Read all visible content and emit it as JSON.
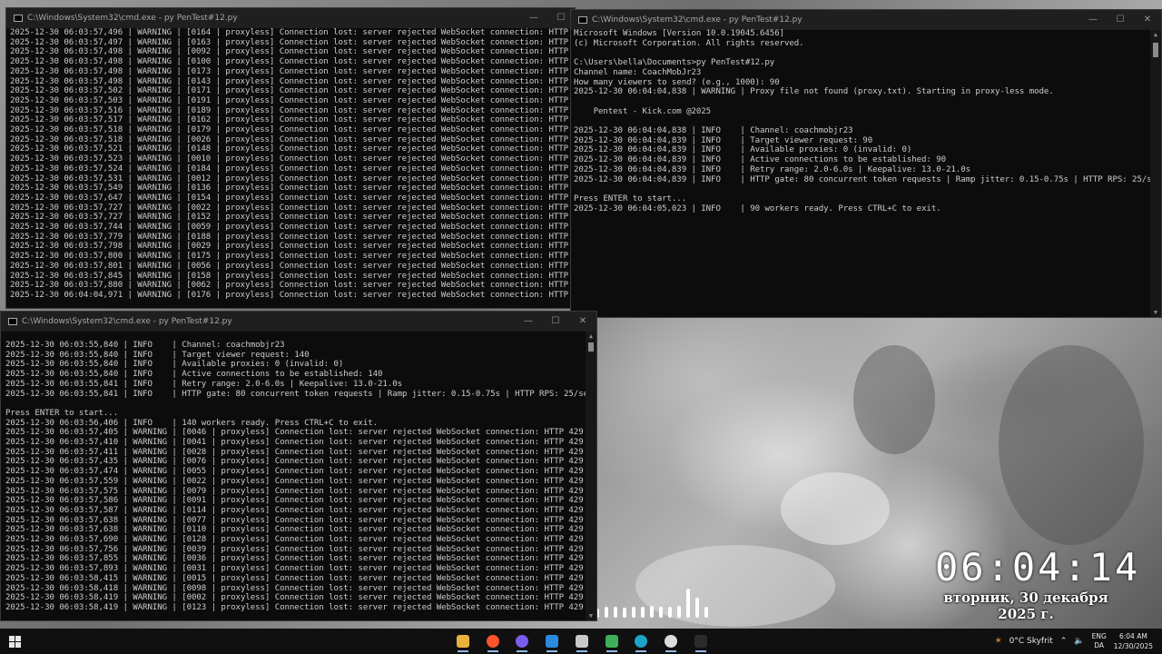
{
  "windows": {
    "cmd_top_left": {
      "title": "C:\\Windows\\System32\\cmd.exe - py  PenTest#12.py",
      "lines": [
        "2025-12-30 06:03:57,496 | WARNING | [0164 | proxyless] Connection lost: server rejected WebSocket connection: HTTP 429",
        "2025-12-30 06:03:57,497 | WARNING | [0163 | proxyless] Connection lost: server rejected WebSocket connection: HTTP 429",
        "2025-12-30 06:03:57,498 | WARNING | [0092 | proxyless] Connection lost: server rejected WebSocket connection: HTTP 429",
        "2025-12-30 06:03:57,498 | WARNING | [0100 | proxyless] Connection lost: server rejected WebSocket connection: HTTP 429",
        "2025-12-30 06:03:57,498 | WARNING | [0173 | proxyless] Connection lost: server rejected WebSocket connection: HTTP 429",
        "2025-12-30 06:03:57,498 | WARNING | [0143 | proxyless] Connection lost: server rejected WebSocket connection: HTTP 429",
        "2025-12-30 06:03:57,502 | WARNING | [0171 | proxyless] Connection lost: server rejected WebSocket connection: HTTP 429",
        "2025-12-30 06:03:57,503 | WARNING | [0191 | proxyless] Connection lost: server rejected WebSocket connection: HTTP 429",
        "2025-12-30 06:03:57,516 | WARNING | [0189 | proxyless] Connection lost: server rejected WebSocket connection: HTTP 429",
        "2025-12-30 06:03:57,517 | WARNING | [0162 | proxyless] Connection lost: server rejected WebSocket connection: HTTP 429",
        "2025-12-30 06:03:57,518 | WARNING | [0179 | proxyless] Connection lost: server rejected WebSocket connection: HTTP 429",
        "2025-12-30 06:03:57,518 | WARNING | [0026 | proxyless] Connection lost: server rejected WebSocket connection: HTTP 429",
        "2025-12-30 06:03:57,521 | WARNING | [0148 | proxyless] Connection lost: server rejected WebSocket connection: HTTP 429",
        "2025-12-30 06:03:57,523 | WARNING | [0010 | proxyless] Connection lost: server rejected WebSocket connection: HTTP 429",
        "2025-12-30 06:03:57,524 | WARNING | [0184 | proxyless] Connection lost: server rejected WebSocket connection: HTTP 429",
        "2025-12-30 06:03:57,531 | WARNING | [0012 | proxyless] Connection lost: server rejected WebSocket connection: HTTP 429",
        "2025-12-30 06:03:57,549 | WARNING | [0136 | proxyless] Connection lost: server rejected WebSocket connection: HTTP 429",
        "2025-12-30 06:03:57,647 | WARNING | [0154 | proxyless] Connection lost: server rejected WebSocket connection: HTTP 429",
        "2025-12-30 06:03:57,727 | WARNING | [0022 | proxyless] Connection lost: server rejected WebSocket connection: HTTP 429",
        "2025-12-30 06:03:57,727 | WARNING | [0152 | proxyless] Connection lost: server rejected WebSocket connection: HTTP 429",
        "2025-12-30 06:03:57,744 | WARNING | [0059 | proxyless] Connection lost: server rejected WebSocket connection: HTTP 429",
        "2025-12-30 06:03:57,779 | WARNING | [0188 | proxyless] Connection lost: server rejected WebSocket connection: HTTP 429",
        "2025-12-30 06:03:57,798 | WARNING | [0029 | proxyless] Connection lost: server rejected WebSocket connection: HTTP 429",
        "2025-12-30 06:03:57,800 | WARNING | [0175 | proxyless] Connection lost: server rejected WebSocket connection: HTTP 429",
        "2025-12-30 06:03:57,801 | WARNING | [0056 | proxyless] Connection lost: server rejected WebSocket connection: HTTP 429",
        "2025-12-30 06:03:57,845 | WARNING | [0158 | proxyless] Connection lost: server rejected WebSocket connection: HTTP 429",
        "2025-12-30 06:03:57,880 | WARNING | [0062 | proxyless] Connection lost: server rejected WebSocket connection: HTTP 429",
        "2025-12-30 06:04:04,971 | WARNING | [0176 | proxyless] Connection lost: server rejected WebSocket connection: HTTP 429"
      ]
    },
    "cmd_top_right": {
      "title": "C:\\Windows\\System32\\cmd.exe - py  PenTest#12.py",
      "lines": [
        "Microsoft Windows [Version 10.0.19045.6456]",
        "(c) Microsoft Corporation. All rights reserved.",
        "",
        "C:\\Users\\bella\\Documents>py PenTest#12.py",
        "Channel name: CoachMobJr23",
        "How many viewers to send? (e.g., 1000): 90",
        "2025-12-30 06:04:04,838 | WARNING | Proxy file not found (proxy.txt). Starting in proxy-less mode.",
        "",
        "    Pentest - Kick.com @2025",
        "",
        "2025-12-30 06:04:04,838 | INFO    | Channel: coachmobjr23",
        "2025-12-30 06:04:04,839 | INFO    | Target viewer request: 90",
        "2025-12-30 06:04:04,839 | INFO    | Available proxies: 0 (invalid: 0)",
        "2025-12-30 06:04:04,839 | INFO    | Active connections to be established: 90",
        "2025-12-30 06:04:04,839 | INFO    | Retry range: 2.0-6.0s | Keepalive: 13.0-21.0s",
        "2025-12-30 06:04:04,839 | INFO    | HTTP gate: 80 concurrent token requests | Ramp jitter: 0.15-0.75s | HTTP RPS: 25/sec",
        "",
        "Press ENTER to start...",
        "2025-12-30 06:04:05,023 | INFO    | 90 workers ready. Press CTRL+C to exit."
      ]
    },
    "cmd_bottom": {
      "title": "C:\\Windows\\System32\\cmd.exe - py  PenTest#12.py",
      "lines": [
        "2025-12-30 06:03:55,840 | INFO    | Channel: coachmobjr23",
        "2025-12-30 06:03:55,840 | INFO    | Target viewer request: 140",
        "2025-12-30 06:03:55,840 | INFO    | Available proxies: 0 (invalid: 0)",
        "2025-12-30 06:03:55,840 | INFO    | Active connections to be established: 140",
        "2025-12-30 06:03:55,841 | INFO    | Retry range: 2.0-6.0s | Keepalive: 13.0-21.0s",
        "2025-12-30 06:03:55,841 | INFO    | HTTP gate: 80 concurrent token requests | Ramp jitter: 0.15-0.75s | HTTP RPS: 25/sec",
        "",
        "Press ENTER to start...",
        "2025-12-30 06:03:56,406 | INFO    | 140 workers ready. Press CTRL+C to exit.",
        "2025-12-30 06:03:57,405 | WARNING | [0046 | proxyless] Connection lost: server rejected WebSocket connection: HTTP 429",
        "2025-12-30 06:03:57,410 | WARNING | [0041 | proxyless] Connection lost: server rejected WebSocket connection: HTTP 429",
        "2025-12-30 06:03:57,411 | WARNING | [0028 | proxyless] Connection lost: server rejected WebSocket connection: HTTP 429",
        "2025-12-30 06:03:57,435 | WARNING | [0076 | proxyless] Connection lost: server rejected WebSocket connection: HTTP 429",
        "2025-12-30 06:03:57,474 | WARNING | [0055 | proxyless] Connection lost: server rejected WebSocket connection: HTTP 429",
        "2025-12-30 06:03:57,559 | WARNING | [0022 | proxyless] Connection lost: server rejected WebSocket connection: HTTP 429",
        "2025-12-30 06:03:57,575 | WARNING | [0079 | proxyless] Connection lost: server rejected WebSocket connection: HTTP 429",
        "2025-12-30 06:03:57,586 | WARNING | [0091 | proxyless] Connection lost: server rejected WebSocket connection: HTTP 429",
        "2025-12-30 06:03:57,587 | WARNING | [0114 | proxyless] Connection lost: server rejected WebSocket connection: HTTP 429",
        "2025-12-30 06:03:57,638 | WARNING | [0077 | proxyless] Connection lost: server rejected WebSocket connection: HTTP 429",
        "2025-12-30 06:03:57,638 | WARNING | [0110 | proxyless] Connection lost: server rejected WebSocket connection: HTTP 429",
        "2025-12-30 06:03:57,690 | WARNING | [0128 | proxyless] Connection lost: server rejected WebSocket connection: HTTP 429",
        "2025-12-30 06:03:57,756 | WARNING | [0039 | proxyless] Connection lost: server rejected WebSocket connection: HTTP 429",
        "2025-12-30 06:03:57,855 | WARNING | [0036 | proxyless] Connection lost: server rejected WebSocket connection: HTTP 429",
        "2025-12-30 06:03:57,893 | WARNING | [0031 | proxyless] Connection lost: server rejected WebSocket connection: HTTP 429",
        "2025-12-30 06:03:58,415 | WARNING | [0015 | proxyless] Connection lost: server rejected WebSocket connection: HTTP 429",
        "2025-12-30 06:03:58,418 | WARNING | [0098 | proxyless] Connection lost: server rejected WebSocket connection: HTTP 429",
        "2025-12-30 06:03:58,419 | WARNING | [0002 | proxyless] Connection lost: server rejected WebSocket connection: HTTP 429",
        "2025-12-30 06:03:58,419 | WARNING | [0123 | proxyless] Connection lost: server rejected WebSocket connection: HTTP 429"
      ]
    }
  },
  "window_controls": {
    "minimize": "—",
    "maximize": "☐",
    "close": "✕"
  },
  "clock_widget": {
    "time": "06:04:14",
    "date": "вторник, 30 декабря",
    "year": "2025 г."
  },
  "visualizer_levels": [
    0.25,
    0.3,
    0.3,
    0.28,
    0.3,
    0.3,
    0.32,
    0.3,
    0.3,
    0.32,
    0.8,
    0.55,
    0.3
  ],
  "taskbar": {
    "apps": [
      {
        "name": "file-explorer",
        "color": "#e8b33a"
      },
      {
        "name": "brave",
        "color": "#fb542b"
      },
      {
        "name": "chat-app",
        "color": "#7b5cf0"
      },
      {
        "name": "vscode",
        "color": "#2a8ae0"
      },
      {
        "name": "hard-drive",
        "color": "#c9c9c9"
      },
      {
        "name": "spreadsheet",
        "color": "#3fae5a"
      },
      {
        "name": "edge",
        "color": "#1aa4c8"
      },
      {
        "name": "app-logo",
        "color": "#dcdcdc"
      },
      {
        "name": "terminal",
        "color": "#2b2b2b"
      }
    ],
    "weather": "0°C  Skyfrit",
    "lang_top": "ENG",
    "lang_bottom": "DA",
    "time": "6:04 AM",
    "date": "12/30/2025"
  },
  "colors": {
    "console_bg": "#0c0c0c",
    "console_text": "#cccccc",
    "taskbar_bg": "#101010"
  }
}
